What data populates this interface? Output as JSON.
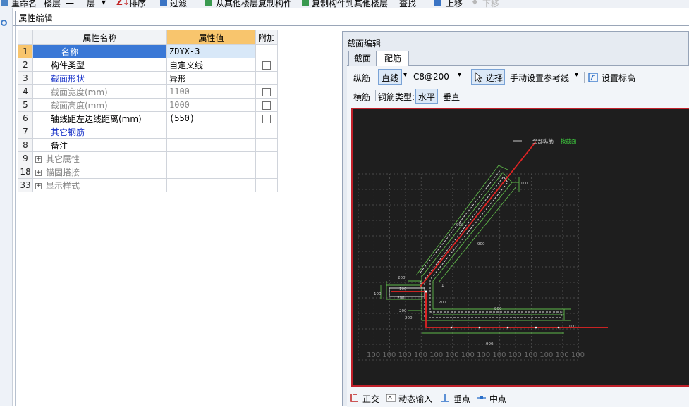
{
  "toolbar": {
    "rename": "重命名",
    "floor_label": "楼层",
    "floor_value": "一",
    "floor_suffix": "层",
    "sort": "排序",
    "filter": "过滤",
    "copy_from_other": "从其他楼层复制构件",
    "copy_to_other": "复制构件到其他楼层",
    "find": "查找",
    "move_up": "上移",
    "move_down": "下移"
  },
  "tab": {
    "label": "属性编辑"
  },
  "props": {
    "headers": {
      "name": "属性名称",
      "value": "属性值",
      "extra": "附加"
    },
    "rows": [
      {
        "num": "1",
        "name": "名称",
        "value": "ZDYX-3"
      },
      {
        "num": "2",
        "name": "构件类型",
        "value": "自定义线"
      },
      {
        "num": "3",
        "name": "截面形状",
        "value": "异形"
      },
      {
        "num": "4",
        "name": "截面宽度(mm)",
        "value": "1100"
      },
      {
        "num": "5",
        "name": "截面高度(mm)",
        "value": "1000"
      },
      {
        "num": "6",
        "name": "轴线距左边线距离(mm)",
        "value": "(550)"
      },
      {
        "num": "7",
        "name": "其它钢筋",
        "value": ""
      },
      {
        "num": "8",
        "name": "备注",
        "value": ""
      },
      {
        "num": "9",
        "name": "其它属性",
        "value": ""
      },
      {
        "num": "18",
        "name": "锚固搭接",
        "value": ""
      },
      {
        "num": "33",
        "name": "显示样式",
        "value": ""
      }
    ]
  },
  "section": {
    "title": "截面编辑",
    "tabs": [
      "截面",
      "配筋"
    ],
    "longitudinal": "纵筋",
    "straight": "直线",
    "spec": "C8@200",
    "select": "选择",
    "manual_ref": "手动设置参考线",
    "set_elev": "设置标高",
    "transverse": "横筋",
    "rebar_type": "钢筋类型:",
    "horizontal": "水平",
    "vertical": "垂直",
    "canvas_label1": "全部纵筋",
    "canvas_label2": "按截面",
    "dims": {
      "d100a": "100",
      "d200a": "200",
      "d100b": "100",
      "d200b": "200",
      "d200c": "200",
      "d800": "800",
      "d900": "900",
      "d100c": "100",
      "d200d": "200",
      "d900b": "900",
      "d100d": "100",
      "d900c": "900",
      "d1a": "1",
      "d1b": "1",
      "d200e": "200"
    },
    "ruler": [
      "100",
      "100",
      "100",
      "100",
      "100",
      "100",
      "100",
      "100",
      "100",
      "100",
      "100",
      "100",
      "100",
      "100"
    ],
    "bottom": {
      "ortho": "正交",
      "dyn_input": "动态输入",
      "perp": "垂点",
      "mid": "中点"
    }
  }
}
